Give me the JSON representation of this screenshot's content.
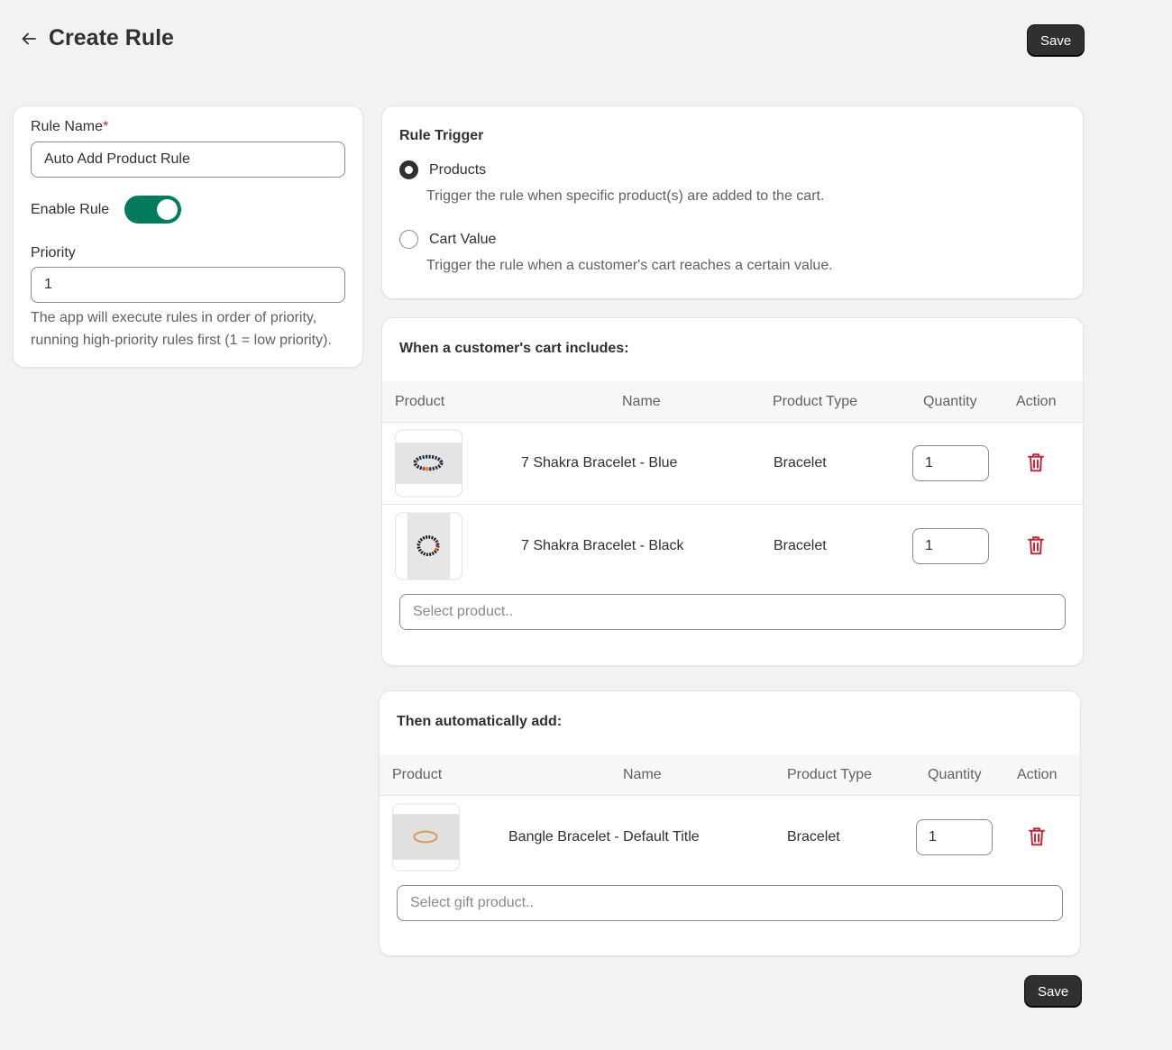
{
  "header": {
    "title": "Create Rule",
    "save_label": "Save"
  },
  "rule_settings": {
    "rule_name_label": "Rule Name",
    "required_mark": "*",
    "rule_name_value": "Auto Add Product Rule",
    "enable_label": "Enable Rule",
    "enabled": true,
    "priority_label": "Priority",
    "priority_value": "1",
    "priority_help": "The app will execute rules in order of priority, running high-priority rules first (1 = low priority)."
  },
  "trigger": {
    "title": "Rule Trigger",
    "options": [
      {
        "label": "Products",
        "description": "Trigger the rule when specific product(s) are added to the cart.",
        "selected": true
      },
      {
        "label": "Cart Value",
        "description": "Trigger the rule when a customer's cart reaches a certain value.",
        "selected": false
      }
    ]
  },
  "cart_includes": {
    "title": "When a customer's cart includes:",
    "columns": [
      "Product",
      "Name",
      "Product Type",
      "Quantity",
      "Action"
    ],
    "rows": [
      {
        "name": "7 Shakra Bracelet - Blue",
        "type": "Bracelet",
        "quantity": "1"
      },
      {
        "name": "7 Shakra Bracelet - Black",
        "type": "Bracelet",
        "quantity": "1"
      }
    ],
    "select_placeholder": "Select product.."
  },
  "auto_add": {
    "title": "Then automatically add:",
    "columns": [
      "Product",
      "Name",
      "Product Type",
      "Quantity",
      "Action"
    ],
    "rows": [
      {
        "name": "Bangle Bracelet - Default Title",
        "type": "Bracelet",
        "quantity": "1"
      }
    ],
    "select_placeholder": "Select gift product.."
  },
  "footer": {
    "save_label": "Save"
  },
  "icons": {
    "back": "arrow-left-icon",
    "delete": "trash-icon"
  },
  "colors": {
    "toggle_on": "#047b5d",
    "primary_button": "#303030",
    "delete_icon": "#c5283d"
  }
}
